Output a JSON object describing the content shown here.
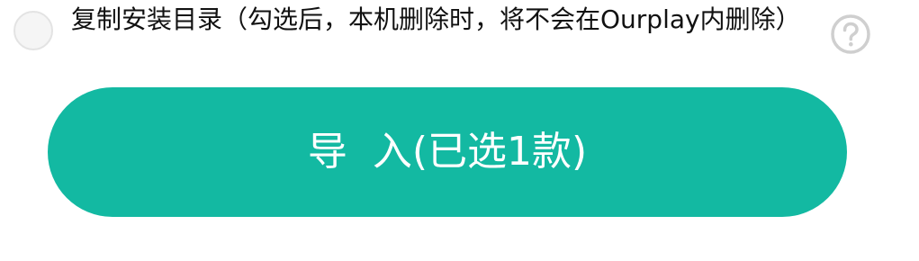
{
  "option": {
    "label": "复制安装目录（勾选后，本机删除时，将不会在Ourplay内删除）",
    "checked": false
  },
  "icons": {
    "radio": "radio-unchecked-icon",
    "help": "question-circle-icon"
  },
  "import_button": {
    "label": "导  入(已选1款)"
  },
  "colors": {
    "accent": "#13b9a2",
    "button_text": "#ffffff",
    "help_icon": "#cfcfcf",
    "radio_border": "#e3e3e3"
  }
}
